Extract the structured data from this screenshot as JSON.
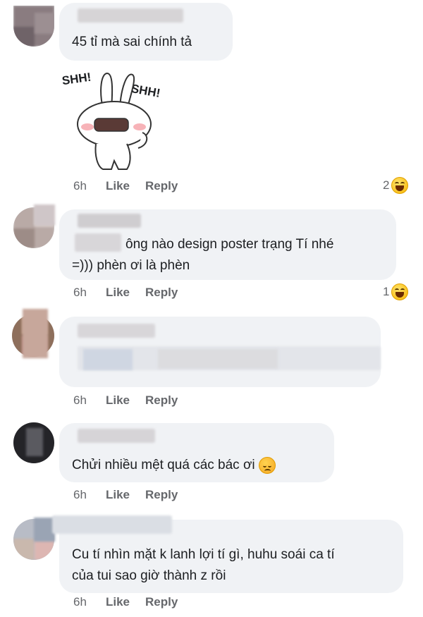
{
  "comments": [
    {
      "text_lines": [
        "45 tỉ mà sai chính tả"
      ],
      "sticker": {
        "name": "shh-bunny-sticker",
        "label_left": "SHH!",
        "label_right": "SHH!"
      },
      "time": "6h",
      "like": "Like",
      "reply": "Reply",
      "reaction": {
        "count": "2",
        "icon": "laugh-emoji"
      }
    },
    {
      "text_lines": [
        "ông nào design poster trạng Tí nhé",
        "=))) phèn ơi là phèn"
      ],
      "time": "6h",
      "like": "Like",
      "reply": "Reply",
      "reaction": {
        "count": "1",
        "icon": "laugh-emoji"
      }
    },
    {
      "text_lines": [],
      "time": "6h",
      "like": "Like",
      "reply": "Reply"
    },
    {
      "text_lines": [
        "Chửi nhiều mệt quá các bác ơi"
      ],
      "inline_emoji": "sad-emoji",
      "time": "6h",
      "like": "Like",
      "reply": "Reply"
    },
    {
      "text_lines": [
        "Cu tí nhìn mặt k lanh lợi tí gì, huhu soái ca tí",
        "của tui sao giờ thành z rồi"
      ],
      "time": "6h",
      "like": "Like",
      "reply": "Reply"
    }
  ],
  "colors": {
    "bubble": "#f0f2f5",
    "meta_text": "#65676b",
    "text": "#1c1e21"
  }
}
